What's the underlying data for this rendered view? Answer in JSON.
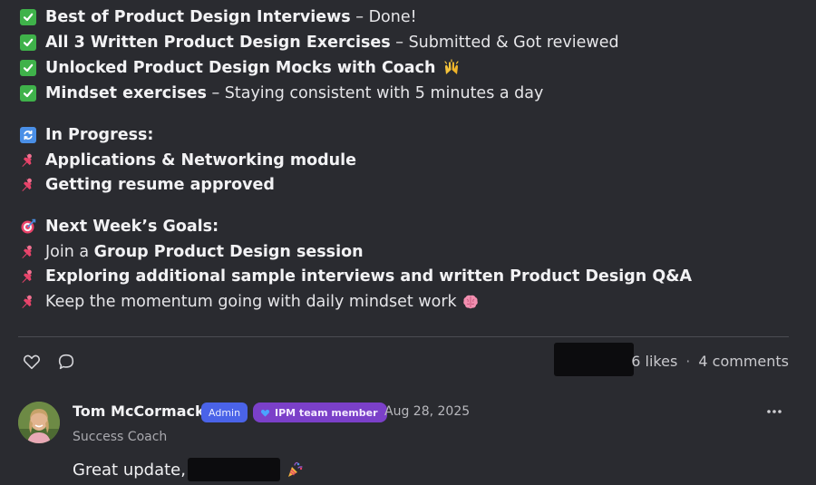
{
  "done_items": [
    {
      "bold": "Best of Product Design Interviews",
      "rest": " – Done!"
    },
    {
      "bold": "All 3 Written Product Design Exercises",
      "rest": " – Submitted & Got reviewed"
    },
    {
      "bold": "Unlocked Product Design Mocks with Coach",
      "rest": ""
    },
    {
      "bold": "Mindset exercises",
      "rest": " – Staying consistent with 5 minutes a day"
    }
  ],
  "in_progress": {
    "heading": "In Progress:",
    "items": [
      "Applications & Networking module",
      "Getting resume approved"
    ]
  },
  "next_week": {
    "heading": "Next Week’s Goals:",
    "items": [
      {
        "pre": "Join a ",
        "bold": "Group Product Design session",
        "post": ""
      },
      {
        "pre": "",
        "bold": "Exploring additional sample interviews and written Product Design Q&A",
        "post": ""
      },
      {
        "pre": "Keep the momentum going with daily mindset work ",
        "bold": "",
        "post": ""
      }
    ]
  },
  "actions": {
    "likes": "6 likes",
    "separator": "·",
    "comments": "4 comments"
  },
  "comment": {
    "author": "Tom McCormack",
    "badge_admin": "Admin",
    "badge_team": "IPM team member",
    "date": "Aug 28, 2025",
    "role": "Success Coach",
    "text": "Great update,"
  },
  "icons": {
    "done": "check-box-icon",
    "progress": "sync-icon",
    "goals": "target-icon",
    "bullet": "pushpin-icon",
    "like": "heart-icon",
    "comment": "comment-bubble-icon",
    "more": "ellipsis-icon"
  },
  "colors": {
    "background": "#2a2b30",
    "admin_badge": "#4a63e8",
    "team_badge": "#7b40c9",
    "check": "#3fb24a"
  }
}
